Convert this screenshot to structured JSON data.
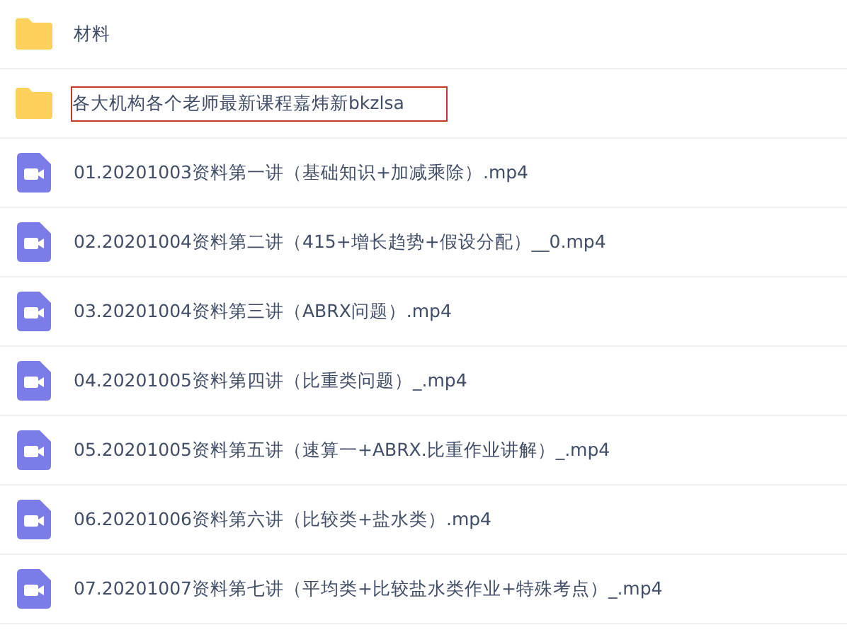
{
  "files": [
    {
      "kind": "folder",
      "name": "材料",
      "outlined": false
    },
    {
      "kind": "folder",
      "name": "各大机构各个老师最新课程嘉炜新bkzlsa",
      "outlined": true
    },
    {
      "kind": "video",
      "name": "01.20201003资料第一讲（基础知识+加减乘除）.mp4",
      "outlined": false
    },
    {
      "kind": "video",
      "name": "02.20201004资料第二讲（415+增长趋势+假设分配）__0.mp4",
      "outlined": false
    },
    {
      "kind": "video",
      "name": "03.20201004资料第三讲（ABRX问题）.mp4",
      "outlined": false
    },
    {
      "kind": "video",
      "name": "04.20201005资料第四讲（比重类问题）_.mp4",
      "outlined": false
    },
    {
      "kind": "video",
      "name": "05.20201005资料第五讲（速算一+ABRX.比重作业讲解）_.mp4",
      "outlined": false
    },
    {
      "kind": "video",
      "name": "06.20201006资料第六讲（比较类+盐水类）.mp4",
      "outlined": false
    },
    {
      "kind": "video",
      "name": "07.20201007资料第七讲（平均类+比较盐水类作业+特殊考点）_.mp4",
      "outlined": false
    }
  ]
}
